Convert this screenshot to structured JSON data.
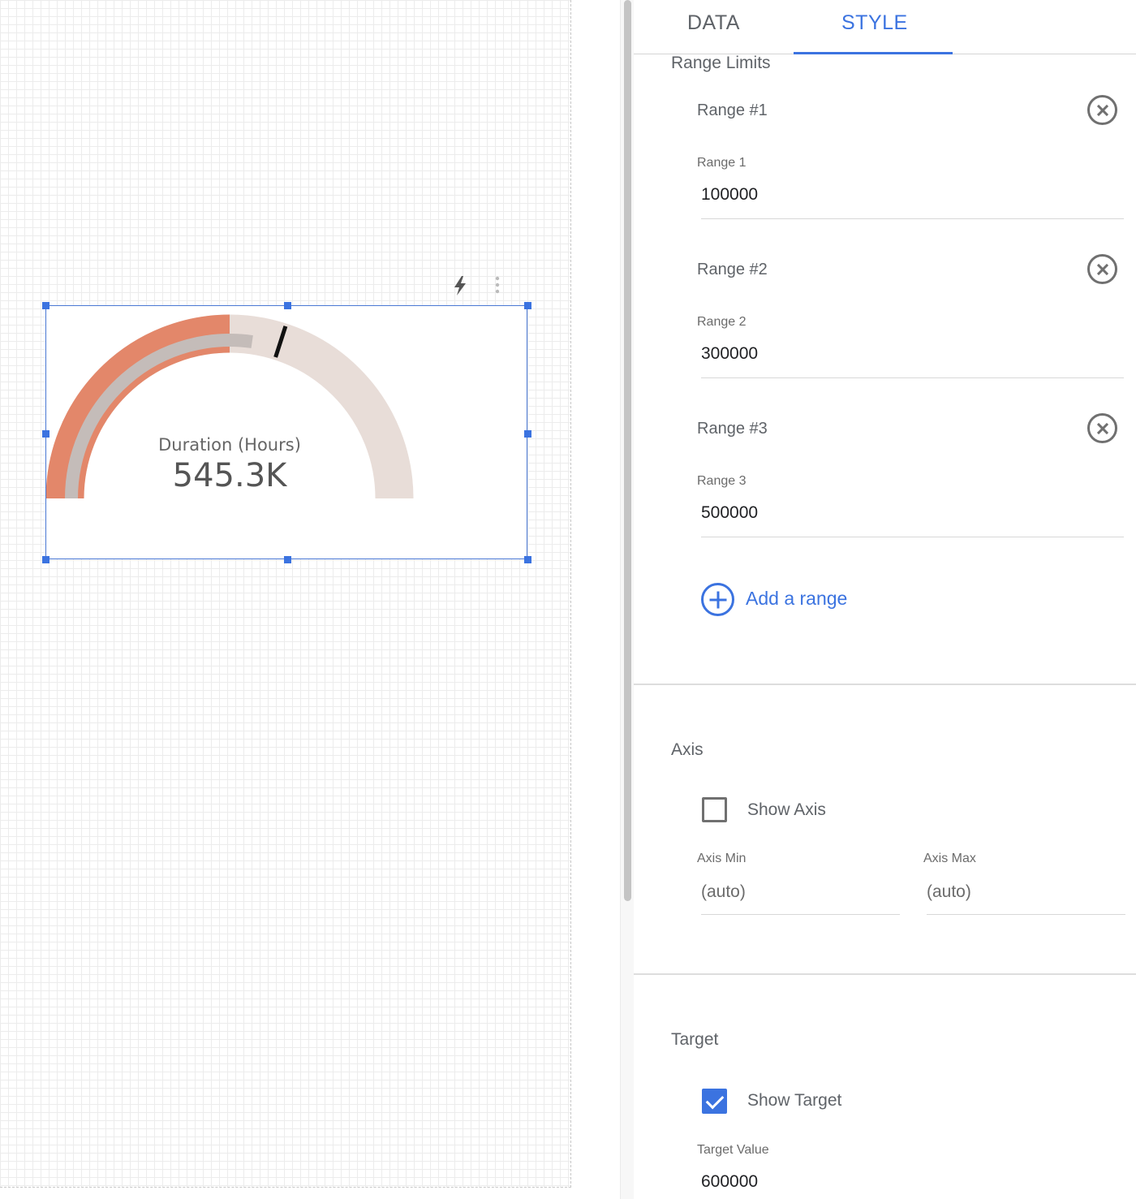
{
  "canvas": {
    "gauge": {
      "metric_label": "Duration (Hours)",
      "value_display": "545.3K",
      "value": 545300,
      "axis_max": 1000000,
      "target": 600000,
      "ranges": [
        100000,
        300000,
        500000
      ],
      "colors": {
        "track": "#e8ddd8",
        "range_fill": "#e3876a",
        "value_bar": "#c4bcb9",
        "target_marker": "#111111",
        "selection": "#3b73e0"
      }
    },
    "toolbar_icons": [
      "lightning-icon",
      "more-vert-icon"
    ]
  },
  "tabs": [
    {
      "label": "DATA",
      "active": false
    },
    {
      "label": "STYLE",
      "active": true
    }
  ],
  "range_limits": {
    "title": "Range Limits",
    "ranges": [
      {
        "title": "Range #1",
        "field_label": "Range 1",
        "value": "100000"
      },
      {
        "title": "Range #2",
        "field_label": "Range 2",
        "value": "300000"
      },
      {
        "title": "Range #3",
        "field_label": "Range 3",
        "value": "500000"
      }
    ],
    "add_label": "Add a range"
  },
  "axis": {
    "title": "Axis",
    "show_axis_label": "Show Axis",
    "show_axis_checked": false,
    "min_label": "Axis Min",
    "min_value": "(auto)",
    "max_label": "Axis Max",
    "max_value": "(auto)"
  },
  "target": {
    "title": "Target",
    "show_target_label": "Show Target",
    "show_target_checked": true,
    "value_label": "Target Value",
    "value": "600000"
  }
}
